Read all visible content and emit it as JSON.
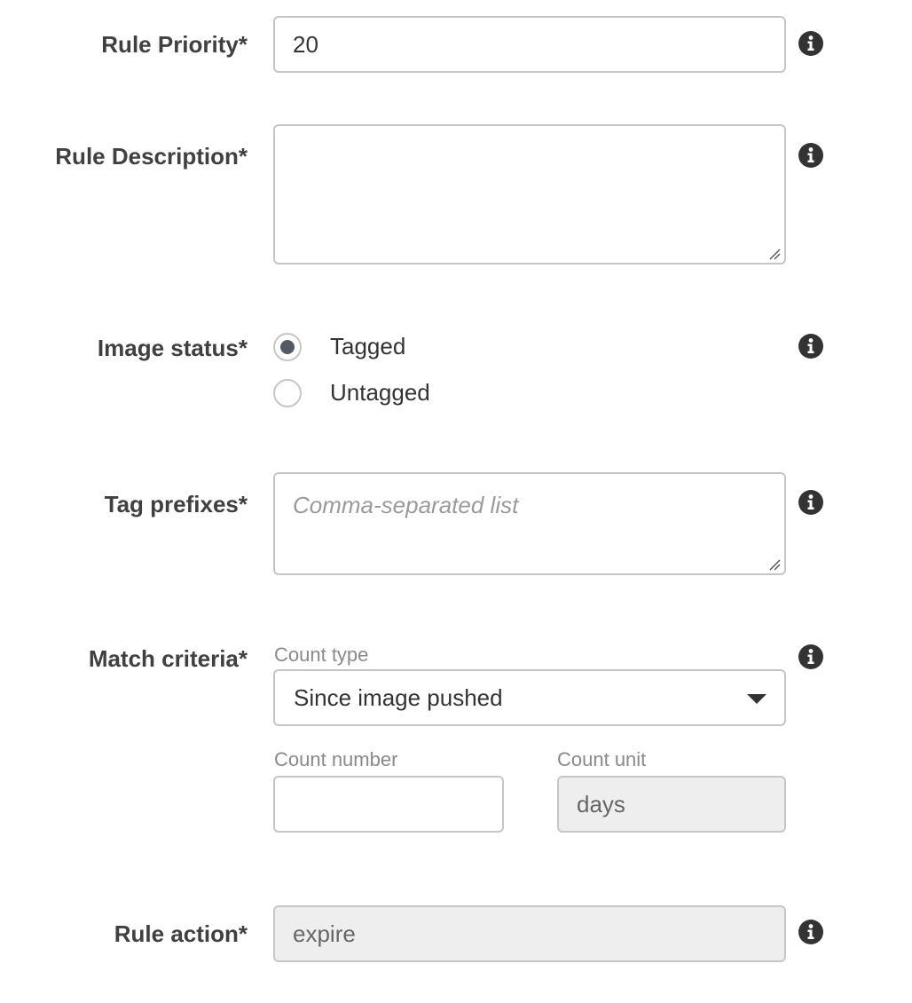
{
  "rule_priority": {
    "label": "Rule Priority*",
    "value": "20",
    "info_icon": "info-icon"
  },
  "rule_description": {
    "label": "Rule Description*",
    "value": "",
    "placeholder": "",
    "info_icon": "info-icon"
  },
  "image_status": {
    "label": "Image status*",
    "options": [
      {
        "label": "Tagged",
        "checked": true
      },
      {
        "label": "Untagged",
        "checked": false
      }
    ],
    "info_icon": "info-icon"
  },
  "tag_prefixes": {
    "label": "Tag prefixes*",
    "value": "",
    "placeholder": "Comma-separated list",
    "info_icon": "info-icon"
  },
  "match_criteria": {
    "label": "Match criteria*",
    "count_type": {
      "label": "Count type",
      "selected": "Since image pushed"
    },
    "count_number": {
      "label": "Count number",
      "value": ""
    },
    "count_unit": {
      "label": "Count unit",
      "value": "days"
    },
    "info_icon": "info-icon"
  },
  "rule_action": {
    "label": "Rule action*",
    "value": "expire",
    "info_icon": "info-icon"
  },
  "colors": {
    "label_text": "#404040",
    "input_border": "#c6c6c6",
    "readonly_background": "#eeeeee",
    "radio_selected": "#545b64",
    "sublabel_text": "#8a8a8a",
    "icon": "#333333"
  }
}
